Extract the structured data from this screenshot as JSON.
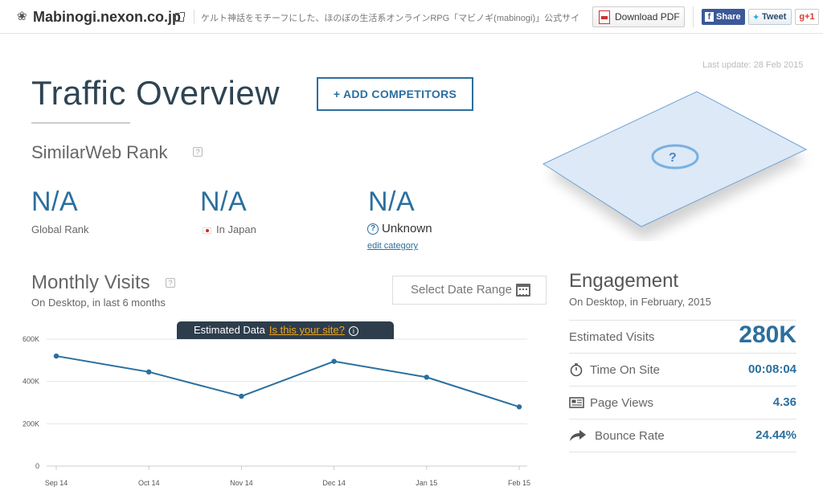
{
  "header": {
    "site_name": "Mabinogi.nexon.co.jp",
    "description": "ケルト神話をモチーフにした、ほのぼの生活系オンラインRPG「マビノギ(mabinogi)」公式サイト。…",
    "download_pdf": "Download PDF",
    "share_fb": "Share",
    "share_tw": "Tweet",
    "share_gplus": "g+1"
  },
  "page": {
    "last_update": "Last update: 28 Feb 2015",
    "title": "Traffic Overview",
    "add_competitors": "+ ADD COMPETITORS"
  },
  "rank": {
    "title": "SimilarWeb Rank",
    "help": "?",
    "global_value": "N/A",
    "global_label": "Global Rank",
    "country_value": "N/A",
    "country_label": "In Japan",
    "category_value": "N/A",
    "category_label": "Unknown",
    "edit_category": "edit category"
  },
  "monthly": {
    "title": "Monthly Visits",
    "help": "?",
    "subtitle": "On Desktop, in last 6 months",
    "date_range": "Select Date Range",
    "banner_text": "Estimated Data",
    "banner_link": "Is this your site?",
    "banner_info": "i"
  },
  "chart_data": {
    "type": "line",
    "categories": [
      "Sep 14",
      "Oct 14",
      "Nov 14",
      "Dec 14",
      "Jan 15",
      "Feb 15"
    ],
    "series": [
      {
        "values": [
          520000,
          445000,
          330000,
          495000,
          420000,
          280000
        ]
      }
    ],
    "ytick_labels": [
      "0",
      "200K",
      "400K",
      "600K"
    ],
    "ylim": [
      0,
      600000
    ],
    "grid": true,
    "line_color": "#2b6f9e"
  },
  "engagement": {
    "title": "Engagement",
    "subtitle": "On Desktop, in February, 2015",
    "rows": [
      {
        "label": "Estimated Visits",
        "value": "280K"
      },
      {
        "label": "Time On Site",
        "value": "00:08:04",
        "icon": "stopwatch-icon"
      },
      {
        "label": "Page Views",
        "value": "4.36",
        "icon": "pages-icon"
      },
      {
        "label": "Bounce Rate",
        "value": "24.44%",
        "icon": "bounce-arrow-icon"
      }
    ]
  }
}
